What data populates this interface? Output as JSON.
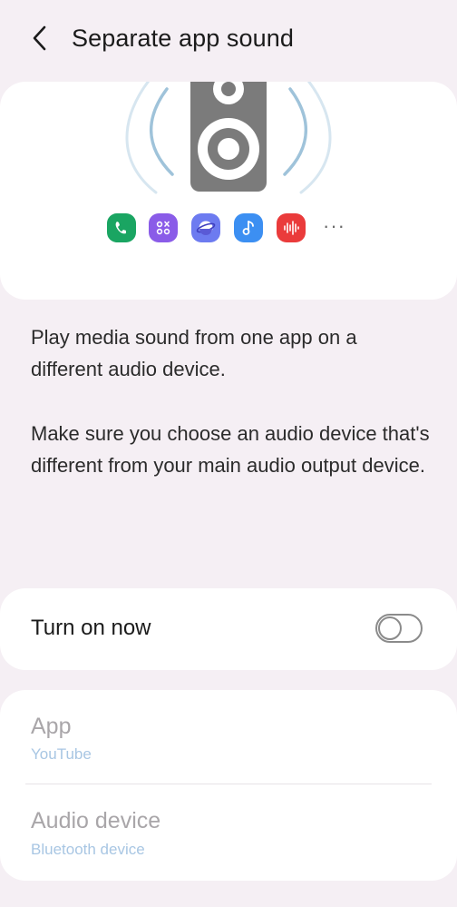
{
  "header": {
    "title": "Separate app sound",
    "back_icon": "chevron-left-icon"
  },
  "illustration": {
    "speaker_icon": "speaker-icon",
    "apps": [
      {
        "icon": "phone-icon",
        "color": "#1aa562"
      },
      {
        "icon": "calculator-icon",
        "color": "#8a5ce8"
      },
      {
        "icon": "internet-icon",
        "color": "#6d7bf0"
      },
      {
        "icon": "music-icon",
        "color": "#3c8ff2"
      },
      {
        "icon": "voice-recorder-icon",
        "color": "#ea3b3b"
      }
    ],
    "more_label": "···"
  },
  "description": {
    "paragraph_1": "Play media sound from one app on a different audio device.",
    "paragraph_2": "Make sure you choose an audio device that's different from your main audio output device."
  },
  "toggle": {
    "label": "Turn on now",
    "state": "off"
  },
  "settings": {
    "app": {
      "label": "App",
      "value": "YouTube"
    },
    "audio_device": {
      "label": "Audio device",
      "value": "Bluetooth device"
    }
  },
  "colors": {
    "background": "#f5eff4",
    "card": "#ffffff",
    "speaker": "#7b7b7b",
    "sound_waves": "#b7d3e6",
    "disabled_text": "#a9a6a9",
    "disabled_accent": "#a8c6e3"
  }
}
